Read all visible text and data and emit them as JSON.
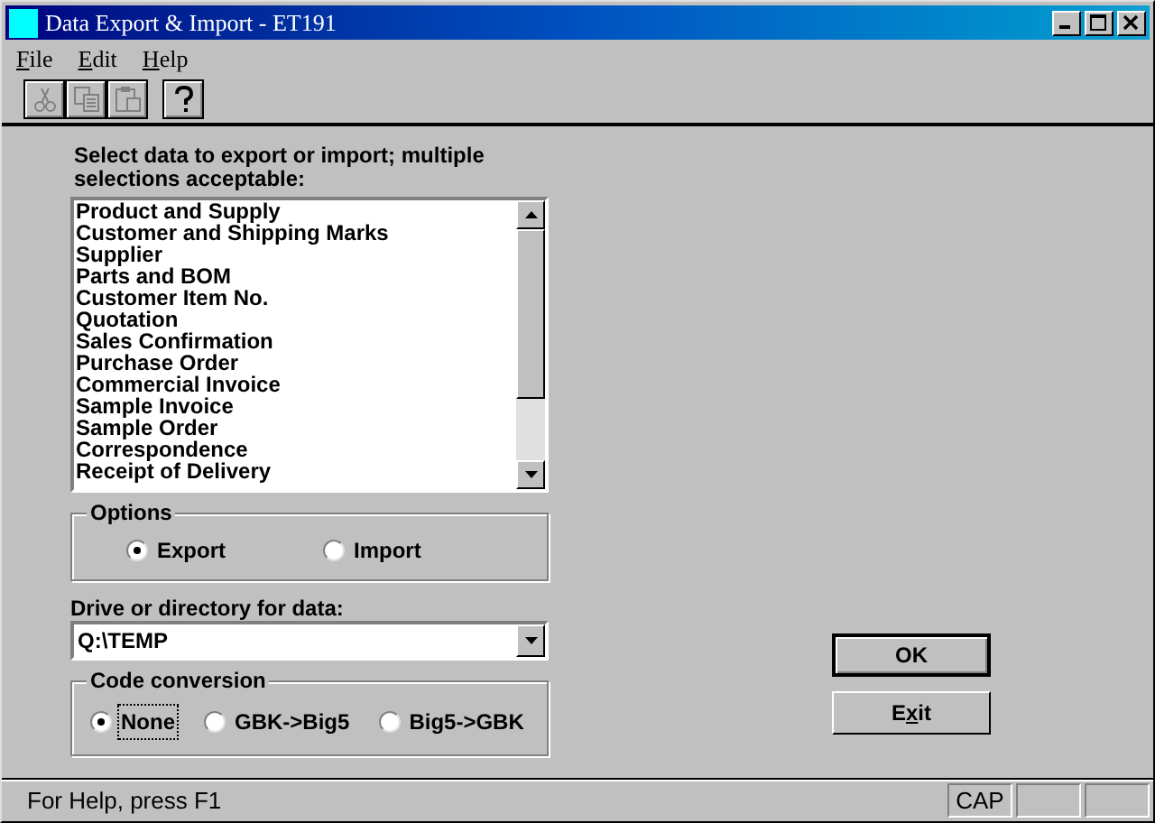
{
  "window": {
    "title": "Data Export & Import - ET191"
  },
  "menu": [
    {
      "access_key": "F",
      "label_rest": "ile"
    },
    {
      "access_key": "E",
      "label_rest": "dit"
    },
    {
      "access_key": "H",
      "label_rest": "elp"
    }
  ],
  "toolbar": [
    {
      "kind": "cut",
      "disabled": true
    },
    {
      "kind": "copy",
      "disabled": true
    },
    {
      "kind": "paste",
      "disabled": true
    },
    {
      "kind": "help",
      "disabled": false
    }
  ],
  "data_list": {
    "label": "Select data to export or import; multiple selections acceptable:",
    "items": [
      {
        "label": "Product and Supply",
        "selected": false
      },
      {
        "label": "Customer and Shipping Marks",
        "selected": false
      },
      {
        "label": "Supplier",
        "selected": false
      },
      {
        "label": "Parts and BOM",
        "selected": false
      },
      {
        "label": "Customer Item No.",
        "selected": false
      },
      {
        "label": "Quotation",
        "selected": false
      },
      {
        "label": "Sales Confirmation",
        "selected": false
      },
      {
        "label": "Purchase Order",
        "selected": false
      },
      {
        "label": "Commercial Invoice",
        "selected": false
      },
      {
        "label": "Sample Invoice",
        "selected": false
      },
      {
        "label": "Sample Order",
        "selected": false
      },
      {
        "label": "Correspondence",
        "selected": false
      },
      {
        "label": "Receipt of Delivery",
        "selected": false
      }
    ]
  },
  "options": {
    "title": "Options",
    "choices": [
      {
        "label": "Export",
        "selected": true,
        "focused": false
      },
      {
        "label": "Import",
        "selected": false,
        "focused": false
      }
    ]
  },
  "directory": {
    "label": "Drive or directory for data:",
    "value": "Q:\\TEMP"
  },
  "code_conversion": {
    "title": "Code conversion",
    "choices": [
      {
        "label": "None",
        "selected": true,
        "focused": true
      },
      {
        "label": "GBK->Big5",
        "selected": false,
        "focused": false
      },
      {
        "label": "Big5->GBK",
        "selected": false,
        "focused": false
      }
    ]
  },
  "buttons": [
    {
      "label_rest": "OK",
      "default": true
    },
    {
      "label_start": "E",
      "access_key": "x",
      "label_rest": "it",
      "default": false
    }
  ],
  "status_bar": {
    "text": "For Help, press F1",
    "indicators": [
      "CAP"
    ]
  }
}
